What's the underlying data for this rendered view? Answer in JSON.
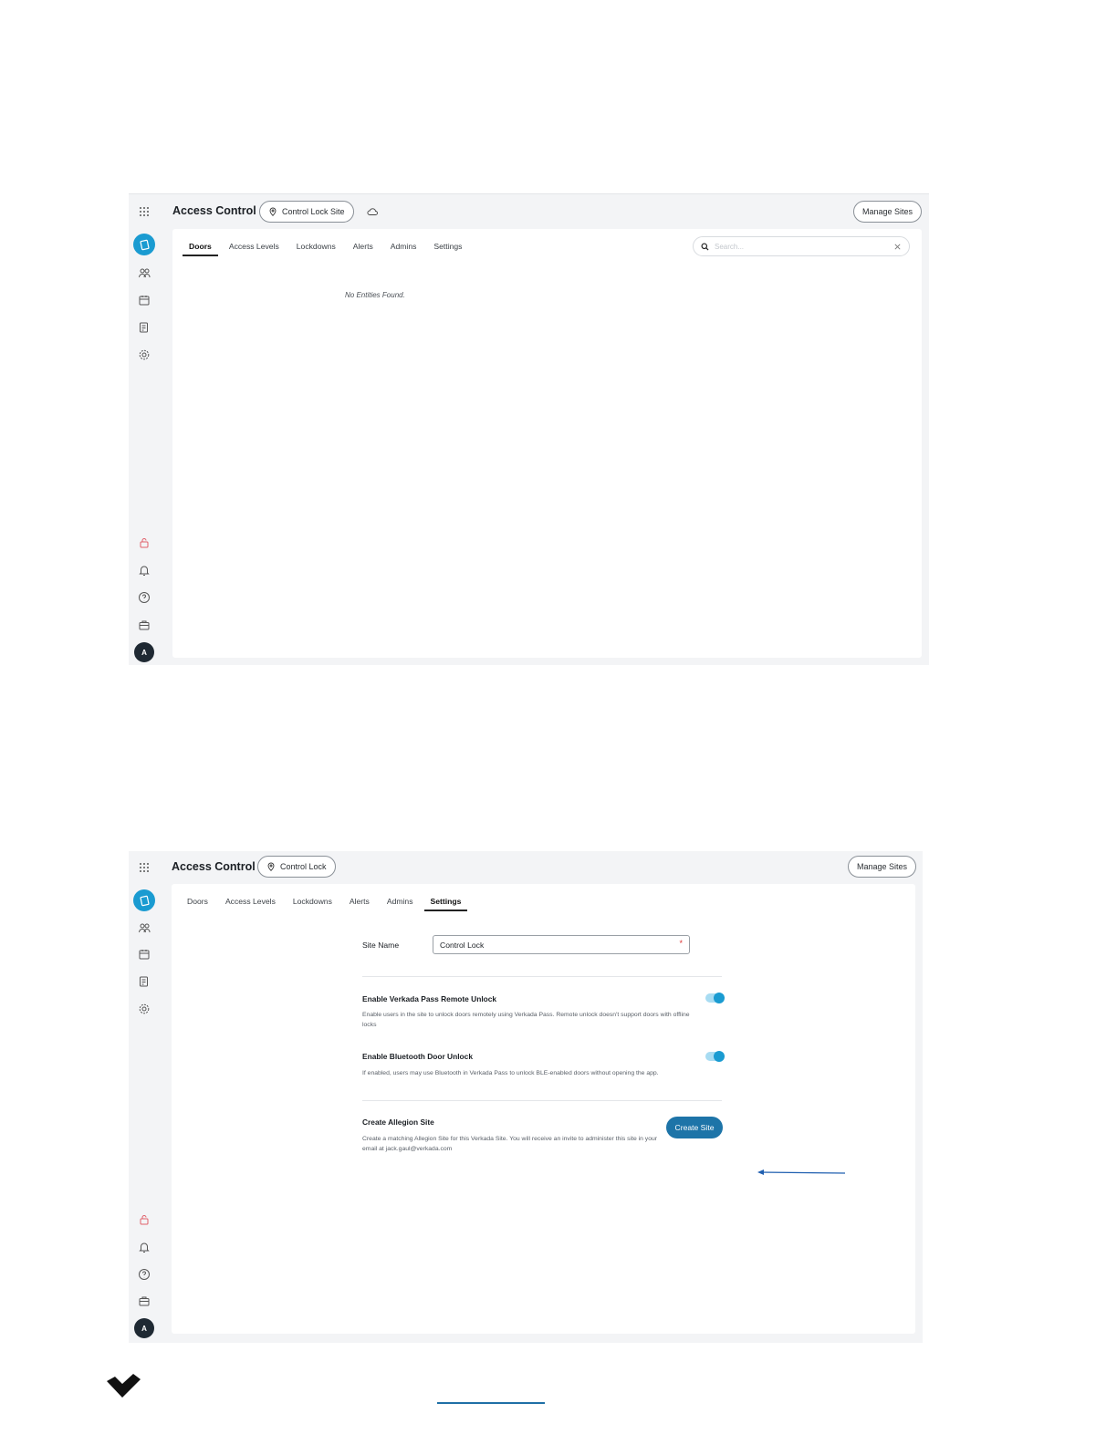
{
  "screenshot1": {
    "app_title": "Access Control",
    "site_pill": "Control Lock Site",
    "manage_sites": "Manage Sites",
    "tabs": [
      {
        "label": "Doors",
        "active": true
      },
      {
        "label": "Access Levels",
        "active": false
      },
      {
        "label": "Lockdowns",
        "active": false
      },
      {
        "label": "Alerts",
        "active": false
      },
      {
        "label": "Admins",
        "active": false
      },
      {
        "label": "Settings",
        "active": false
      }
    ],
    "search_placeholder": "Search...",
    "empty_message": "No Entities Found.",
    "avatar_initial": "A"
  },
  "screenshot2": {
    "app_title": "Access Control",
    "site_pill": "Control Lock",
    "manage_sites": "Manage Sites",
    "tabs": [
      {
        "label": "Doors",
        "active": false
      },
      {
        "label": "Access Levels",
        "active": false
      },
      {
        "label": "Lockdowns",
        "active": false
      },
      {
        "label": "Alerts",
        "active": false
      },
      {
        "label": "Admins",
        "active": false
      },
      {
        "label": "Settings",
        "active": true
      }
    ],
    "site_name_label": "Site Name",
    "site_name_value": "Control Lock",
    "required_mark": "*",
    "remote_unlock": {
      "title": "Enable Verkada Pass Remote Unlock",
      "description": "Enable users in the site to unlock doors remotely using Verkada Pass. Remote unlock doesn't support doors with offline locks",
      "enabled": true
    },
    "bluetooth_unlock": {
      "title": "Enable Bluetooth Door Unlock",
      "description": "If enabled, users may use Bluetooth in Verkada Pass to unlock BLE-enabled doors without opening the app.",
      "enabled": true
    },
    "allegion": {
      "title": "Create Allegion Site",
      "description": "Create a matching Allegion Site for this Verkada Site. You will receive an invite to administer this site in your email at jack.gaul@verkada.com",
      "button": "Create Site"
    },
    "avatar_initial": "A"
  },
  "colors": {
    "accent": "#1a9bd1",
    "primary_button": "#1d74a8",
    "annotation_arrow": "#1f5fb0",
    "lock_icon": "#e0606a"
  },
  "sidebar_icons_top": [
    "apps-grid-icon",
    "access-control-icon",
    "users-icon",
    "calendar-icon",
    "reports-icon",
    "settings-gear-icon"
  ],
  "sidebar_icons_bottom": [
    "lock-icon",
    "bell-icon",
    "help-icon",
    "briefcase-icon",
    "avatar"
  ]
}
